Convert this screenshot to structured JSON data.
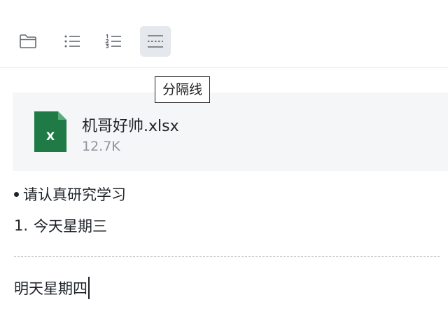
{
  "toolbar": {
    "buttons": [
      {
        "icon": "folder-icon",
        "active": false
      },
      {
        "icon": "bullet-list-icon",
        "active": false
      },
      {
        "icon": "ordered-list-icon",
        "active": false
      },
      {
        "icon": "divider-icon",
        "active": true
      }
    ],
    "tooltip": "分隔线"
  },
  "attachment": {
    "icon": "excel-file-icon",
    "icon_letter": "X",
    "icon_color": "#1f7a45",
    "name": "机哥好帅.xlsx",
    "size": "12.7K"
  },
  "content": {
    "bullet_item": "请认真研究学习",
    "ordered_item": {
      "number": "1.",
      "text": "今天星期三"
    },
    "paragraph": "明天星期四"
  },
  "colors": {
    "active_button_bg": "#e5e8ec",
    "icon_gray": "#646a73",
    "text": "#1f2329",
    "secondary_text": "#8f959e",
    "card_bg": "#f5f6f7"
  }
}
